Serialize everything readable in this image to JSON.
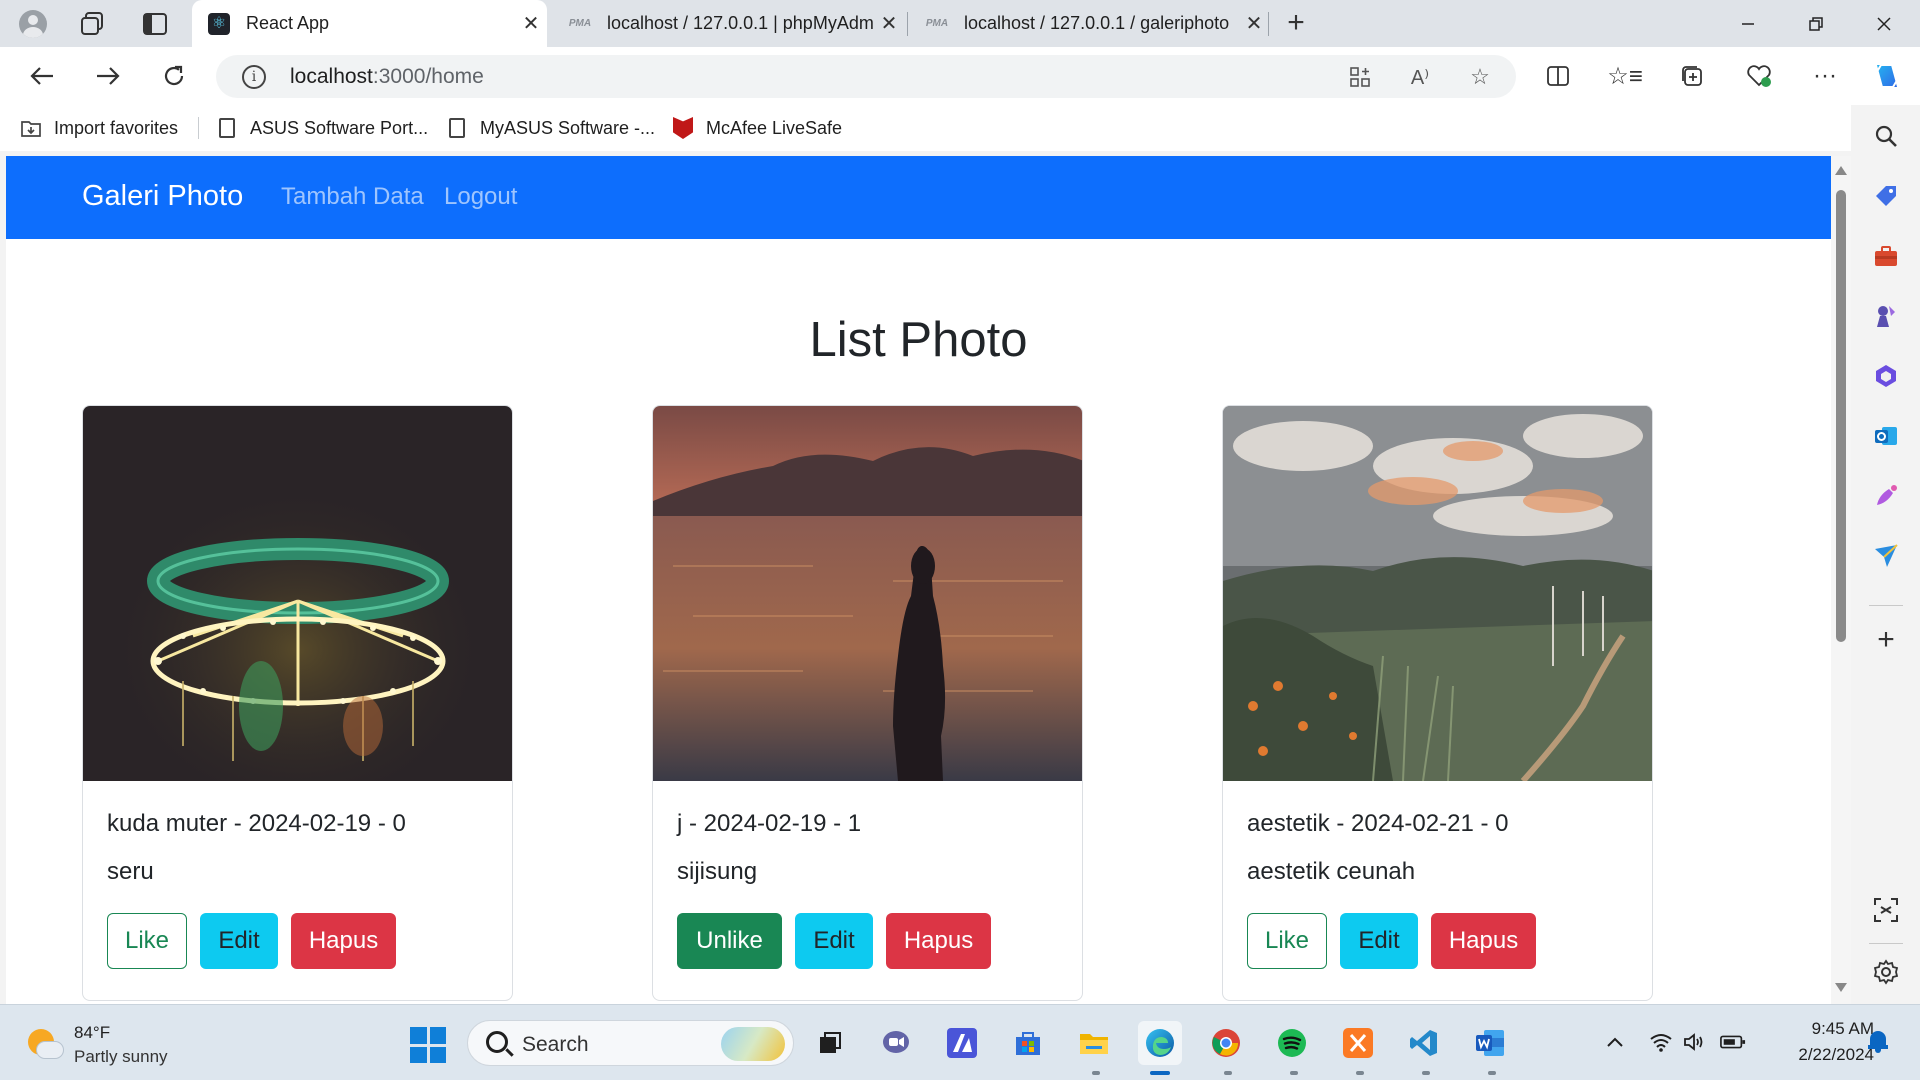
{
  "browser": {
    "tabs": [
      {
        "title": "React App",
        "active": true
      },
      {
        "title": "localhost / 127.0.0.1 | phpMyAdmin",
        "active": false
      },
      {
        "title": "localhost / 127.0.0.1 / galeriphoto",
        "active": false
      }
    ],
    "favicon_pma_label": "PMA",
    "address": {
      "host": "localhost",
      "path": ":3000/home"
    },
    "bookmarks": [
      {
        "label": "Import favorites",
        "icon": "import-favorites-icon"
      },
      {
        "label": "ASUS Software Port...",
        "icon": "page-icon"
      },
      {
        "label": "MyASUS Software -...",
        "icon": "page-icon"
      },
      {
        "label": "McAfee LiveSafe",
        "icon": "mcafee-icon"
      }
    ]
  },
  "app": {
    "navbar": {
      "brand": "Galeri Photo",
      "links": [
        "Tambah Data",
        "Logout"
      ],
      "color": "#0d6efd"
    },
    "page_title": "List Photo",
    "photos": [
      {
        "meta": "kuda muter - 2024-02-19 - 0",
        "description": "seru",
        "like_label": "Like",
        "liked": false,
        "edit_label": "Edit",
        "delete_label": "Hapus",
        "image": "carousel-night-photo"
      },
      {
        "meta": "j - 2024-02-19 - 1",
        "description": "sijisung",
        "like_label": "Unlike",
        "liked": true,
        "edit_label": "Edit",
        "delete_label": "Hapus",
        "image": "silhouette-sunset-sea-photo"
      },
      {
        "meta": "aestetik - 2024-02-21 - 0",
        "description": "aestetik ceunah",
        "like_label": "Like",
        "liked": false,
        "edit_label": "Edit",
        "delete_label": "Hapus",
        "image": "painted-landscape-photo"
      }
    ],
    "colors": {
      "success": "#198754",
      "info": "#0dcaf0",
      "danger": "#dc3545"
    }
  },
  "taskbar": {
    "weather": {
      "temp": "84°F",
      "condition": "Partly sunny"
    },
    "search_label": "Search",
    "clock": {
      "time": "9:45 AM",
      "date": "2/22/2024"
    }
  }
}
